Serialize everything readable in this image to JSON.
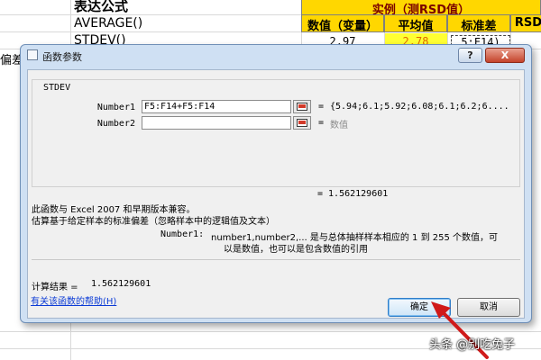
{
  "sheet": {
    "formula_header": "表达公式",
    "formula_rows": [
      "AVERAGE()",
      "STDEV()"
    ],
    "left_partial": "偏差",
    "example_header": "实例（测RSD值）",
    "col_headers": [
      "数值（变量）",
      "平均值",
      "标准差",
      "RSD"
    ],
    "row1": {
      "value": "2.97",
      "average": "2.78",
      "stdev_formula": "5:F14)"
    },
    "colors": {
      "highlight": "#ffd700",
      "average_text": "#e06a00"
    }
  },
  "dialog": {
    "title": "函数参数",
    "help_button": "?",
    "close_button": "X",
    "function_name": "STDEV",
    "args": [
      {
        "label": "Number1",
        "value": "F5:F14+F5:F14",
        "result": "{5.94;6.1;5.92;6.08;6.1;6.2;6...."
      },
      {
        "label": "Number2",
        "value": "",
        "result": "数值"
      }
    ],
    "equals": "=",
    "formula_result_line": "= 1.562129601",
    "description_1": "此函数与 Excel 2007 和早期版本兼容。",
    "description_2": "估算基于给定样本的标准偏差（忽略样本中的逻辑值及文本）",
    "arg_help_label": "Number1:",
    "arg_help_line1": "number1,number2,... 是与总体抽样样本相应的 1 到 255 个数值，可",
    "arg_help_line2": "以是数值，也可以是包含数值的引用",
    "calc_result_label": "计算结果 =",
    "calc_result_value": "1.562129601",
    "help_link": "有关该函数的帮助(H)",
    "ok_button": "确定",
    "cancel_button": "取消"
  },
  "watermark": "头条 @别吃兔子",
  "arrow_color": "#d01a1a"
}
